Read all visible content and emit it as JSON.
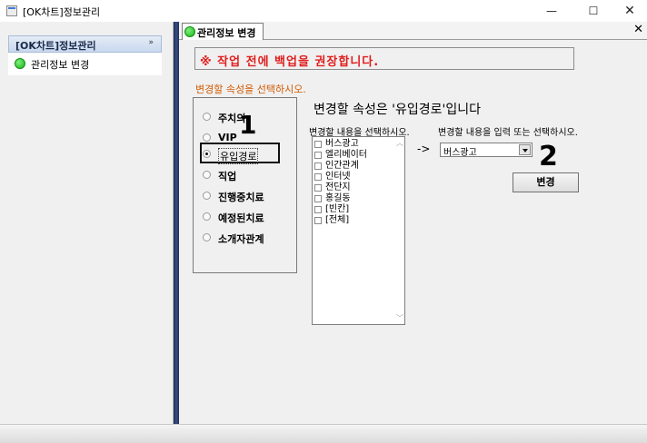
{
  "window": {
    "title": "[OK차트]정보관리",
    "minimize_glyph": "—",
    "maximize_glyph": "☐",
    "close_glyph": "✕"
  },
  "sidebar": {
    "header": "[OK차트]정보관리",
    "collapse_glyph": "»",
    "items": [
      {
        "label": "관리정보 변경",
        "icon": "green-dot-icon"
      }
    ]
  },
  "tab": {
    "label": "관리정보 변경",
    "close_glyph": "✕"
  },
  "form": {
    "warning": "※ 작업 전에 백업을 권장합니다.",
    "select_prompt": "변경할 속성을 선택하시오.",
    "attributes": [
      {
        "label": "주치의",
        "checked": false
      },
      {
        "label": "VIP",
        "checked": false
      },
      {
        "label": "유입경로",
        "checked": true
      },
      {
        "label": "직업",
        "checked": false
      },
      {
        "label": "진행중치료",
        "checked": false
      },
      {
        "label": "예정된치료",
        "checked": false
      },
      {
        "label": "소개자관계",
        "checked": false
      }
    ],
    "heading": "변경할 속성은 '유입경로'입니다",
    "list_label": "변경할 내용을 선택하시오.",
    "input_label": "변경할 내용을 입력 또는 선택하시오.",
    "list_items": [
      "버스광고",
      "엘리베이터",
      "인간관계",
      "인터넷",
      "전단지",
      "홍길동",
      "[빈칸]",
      "[전체]"
    ],
    "arrow": "->",
    "combo_value": "버스광고",
    "change_button": "변경"
  },
  "annotations": {
    "step1": "1",
    "step2": "2"
  },
  "colors": {
    "warning_text": "#e11d1d",
    "prompt_text": "#d25b00",
    "divider": "#1d2d55",
    "status_green": "#18b418"
  }
}
